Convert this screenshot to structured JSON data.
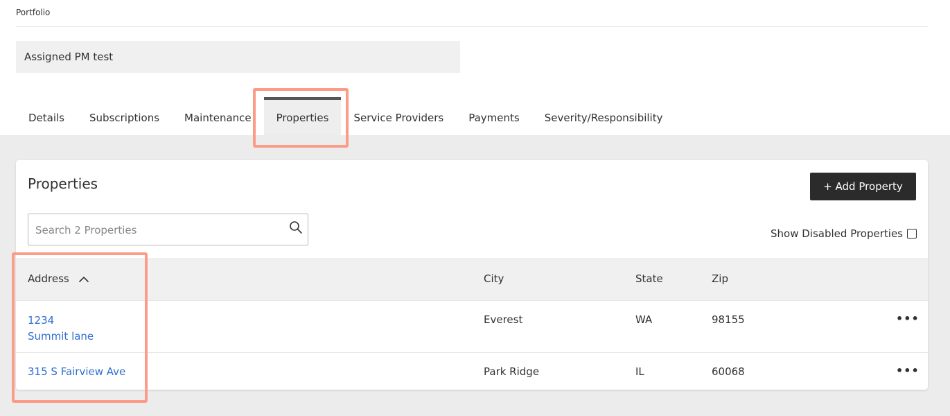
{
  "header": {
    "breadcrumb": "Portfolio",
    "portfolio_name": "Assigned PM test"
  },
  "tabs": [
    {
      "label": "Details",
      "active": false
    },
    {
      "label": "Subscriptions",
      "active": false
    },
    {
      "label": "Maintenance",
      "active": false
    },
    {
      "label": "Properties",
      "active": true
    },
    {
      "label": "Service Providers",
      "active": false
    },
    {
      "label": "Payments",
      "active": false
    },
    {
      "label": "Severity/Responsibility",
      "active": false
    }
  ],
  "properties": {
    "title": "Properties",
    "add_button": "+ Add Property",
    "search_placeholder": "Search 2 Properties",
    "show_disabled_label": "Show Disabled Properties",
    "show_disabled_checked": false,
    "columns": {
      "address": "Address",
      "city": "City",
      "state": "State",
      "zip": "Zip"
    },
    "rows": [
      {
        "address_line1": "1234",
        "address_line2": "Summit lane",
        "city": "Everest",
        "state": "WA",
        "zip": "98155",
        "more": "•••"
      },
      {
        "address_line1": "315 S Fairview Ave",
        "address_line2": "",
        "city": "Park Ridge",
        "state": "IL",
        "zip": "60068",
        "more": "•••"
      }
    ]
  },
  "colors": {
    "highlight": "#fa9c87",
    "link": "#2f6fcf",
    "button_bg": "#2b2b2b",
    "page_bg": "#ececec"
  },
  "icons": {
    "search": "search-icon",
    "sort": "chevron-up-icon",
    "row_menu": "more-horizontal-icon"
  }
}
